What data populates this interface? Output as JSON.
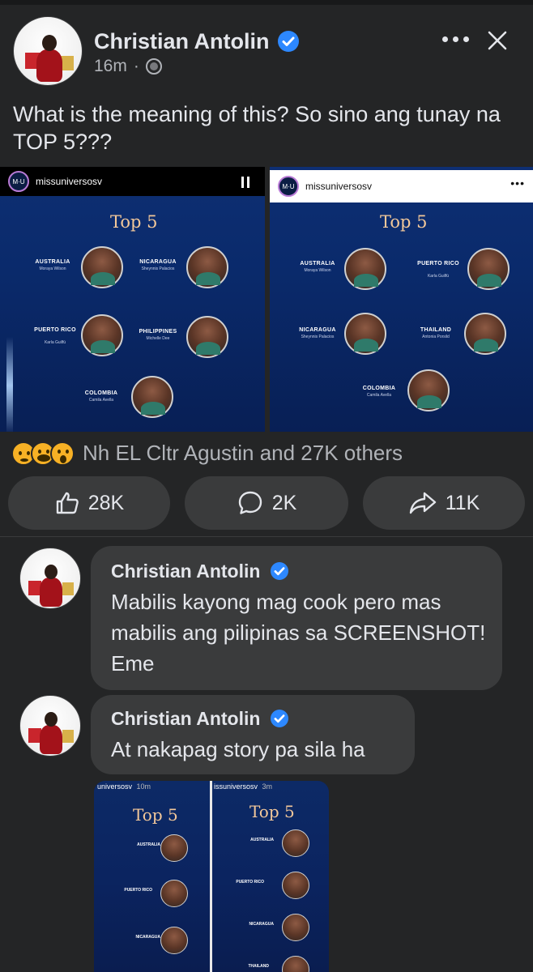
{
  "post": {
    "author": "Christian Antolin",
    "time": "16m",
    "separator": "·",
    "text": "What is the meaning of this? So sino ang tunay na TOP 5???"
  },
  "images": {
    "left": {
      "account": "missuniversosv",
      "title": "Top 5",
      "candidates": [
        {
          "country": "AUSTRALIA",
          "name": "Moraya Wilson"
        },
        {
          "country": "NICARAGUA",
          "name": "Sheynnis Palacios"
        },
        {
          "country": "PUERTO RICO",
          "name": "Karla Guilfú"
        },
        {
          "country": "PHILIPPINES",
          "name": "Michelle Dee"
        },
        {
          "country": "COLOMBIA",
          "name": "Camila Avella"
        }
      ]
    },
    "right": {
      "account": "missuniversosv",
      "menu": "•••",
      "title": "Top 5",
      "candidates": [
        {
          "country": "AUSTRALIA",
          "name": "Moraya Wilson"
        },
        {
          "country": "PUERTO RICO",
          "name": "Karla Guilfú"
        },
        {
          "country": "NICARAGUA",
          "name": "Sheynnis Palacios"
        },
        {
          "country": "THAILAND",
          "name": "Antonia Porsild"
        },
        {
          "country": "COLOMBIA",
          "name": "Camila Avella"
        }
      ]
    }
  },
  "reactions": {
    "icons": [
      "sad-icon",
      "haha-icon",
      "wow-icon"
    ],
    "label": "Nh EL Cltr Agustin and 27K others"
  },
  "actions": {
    "like": "28K",
    "comment": "2K",
    "share": "11K"
  },
  "comments": [
    {
      "author": "Christian Antolin",
      "text": "Mabilis kayong mag cook pero mas mabilis ang pilipinas sa SCREENSHOT! Eme"
    },
    {
      "author": "Christian Antolin",
      "text": "At nakapag story pa sila ha"
    }
  ],
  "story_attachment": {
    "left_caption": "universosv",
    "left_time": "10m",
    "right_caption": "issuniversosv",
    "right_time": "3m",
    "title": "Top 5",
    "left_countries": [
      "AUSTRALIA",
      "PUERTO RICO",
      "NICARAGUA"
    ],
    "right_countries": [
      "AUSTRALIA",
      "PUERTO RICO",
      "NICARAGUA",
      "THAILAND"
    ]
  },
  "colors": {
    "background": "#242526",
    "bubble": "#3a3b3c",
    "verified": "#2d88ff",
    "muted_text": "#b0b3b8"
  }
}
